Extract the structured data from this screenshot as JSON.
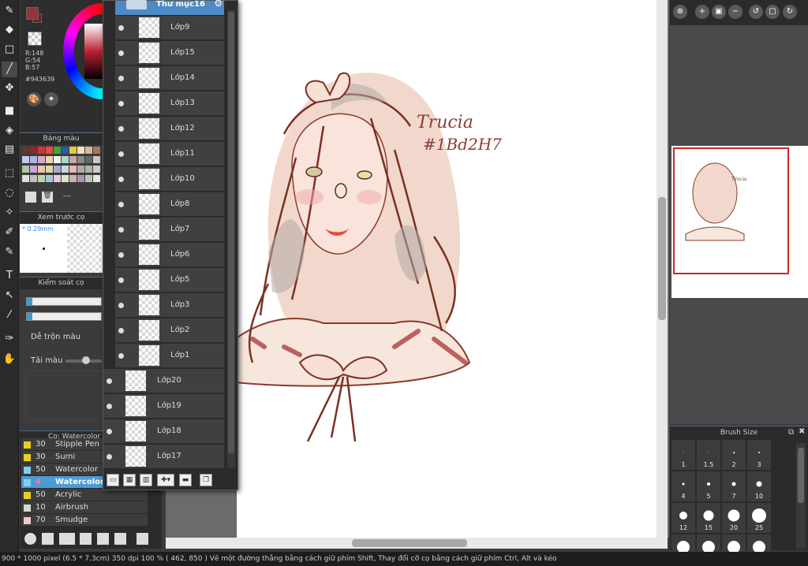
{
  "color_panel": {
    "r_label": "R:148",
    "g_label": "G:54",
    "b_label": "B:57",
    "hex": "#943639",
    "main_color": "#943639"
  },
  "palette_panel": {
    "title": "Bảng màu",
    "footer_label": "---"
  },
  "brush_preview": {
    "title": "Xem trước cọ",
    "size_label": "* 0.29mm"
  },
  "brush_control": {
    "title": "Kiểm soát cọ",
    "blend_label": "Dễ trộn màu",
    "reload_label": "Tải màu"
  },
  "layers": {
    "folder_name": "Thư mục16",
    "inside_folder": [
      {
        "name": "Lớp9"
      },
      {
        "name": "Lớp15"
      },
      {
        "name": "Lớp14"
      },
      {
        "name": "Lớp13"
      },
      {
        "name": "Lớp12"
      },
      {
        "name": "Lớp11"
      },
      {
        "name": "Lớp10"
      },
      {
        "name": "Lớp8"
      },
      {
        "name": "Lớp7"
      },
      {
        "name": "Lớp6"
      },
      {
        "name": "Lớp5"
      },
      {
        "name": "Lớp3"
      },
      {
        "name": "Lớp2"
      },
      {
        "name": "Lớp1"
      }
    ],
    "outside_folder": [
      {
        "name": "Lớp20"
      },
      {
        "name": "Lớp19"
      },
      {
        "name": "Lớp18"
      },
      {
        "name": "Lớp17"
      }
    ]
  },
  "brush_list": {
    "title": "Cọ: Watercolor (",
    "items": [
      {
        "size": "30",
        "name": "Stipple Pen",
        "color": "#e6d020"
      },
      {
        "size": "30",
        "name": "Sumi",
        "color": "#e6d020"
      },
      {
        "size": "50",
        "name": "Watercolor",
        "color": "#7fd0ee"
      },
      {
        "size": "4",
        "name": "Watercolor",
        "color": "#7fd0ee",
        "selected": true
      },
      {
        "size": "50",
        "name": "Acrylic",
        "color": "#e6d020"
      },
      {
        "size": "10",
        "name": "Airbrush",
        "color": "#d8d8d8"
      },
      {
        "size": "70",
        "name": "Smudge",
        "color": "#f0c8c8"
      }
    ]
  },
  "artwork": {
    "signature_line1": "Trucia",
    "signature_line2": "#1Bd2H7"
  },
  "brush_size": {
    "title": "Brush Size",
    "sizes": [
      "1",
      "1.5",
      "2",
      "3",
      "4",
      "5",
      "7",
      "10",
      "12",
      "15",
      "20",
      "25",
      "",
      "",
      "",
      ""
    ]
  },
  "status": {
    "text": "900 * 1000 pixel  (6.5 * 7.3cm)  350 dpi  100 %  ( 462, 850 )  Vẽ một đường thẳng bằng cách giữ phím Shift, Thay đổi cỡ cọ bằng cách giữ phím Ctrl, Alt và kéo"
  }
}
